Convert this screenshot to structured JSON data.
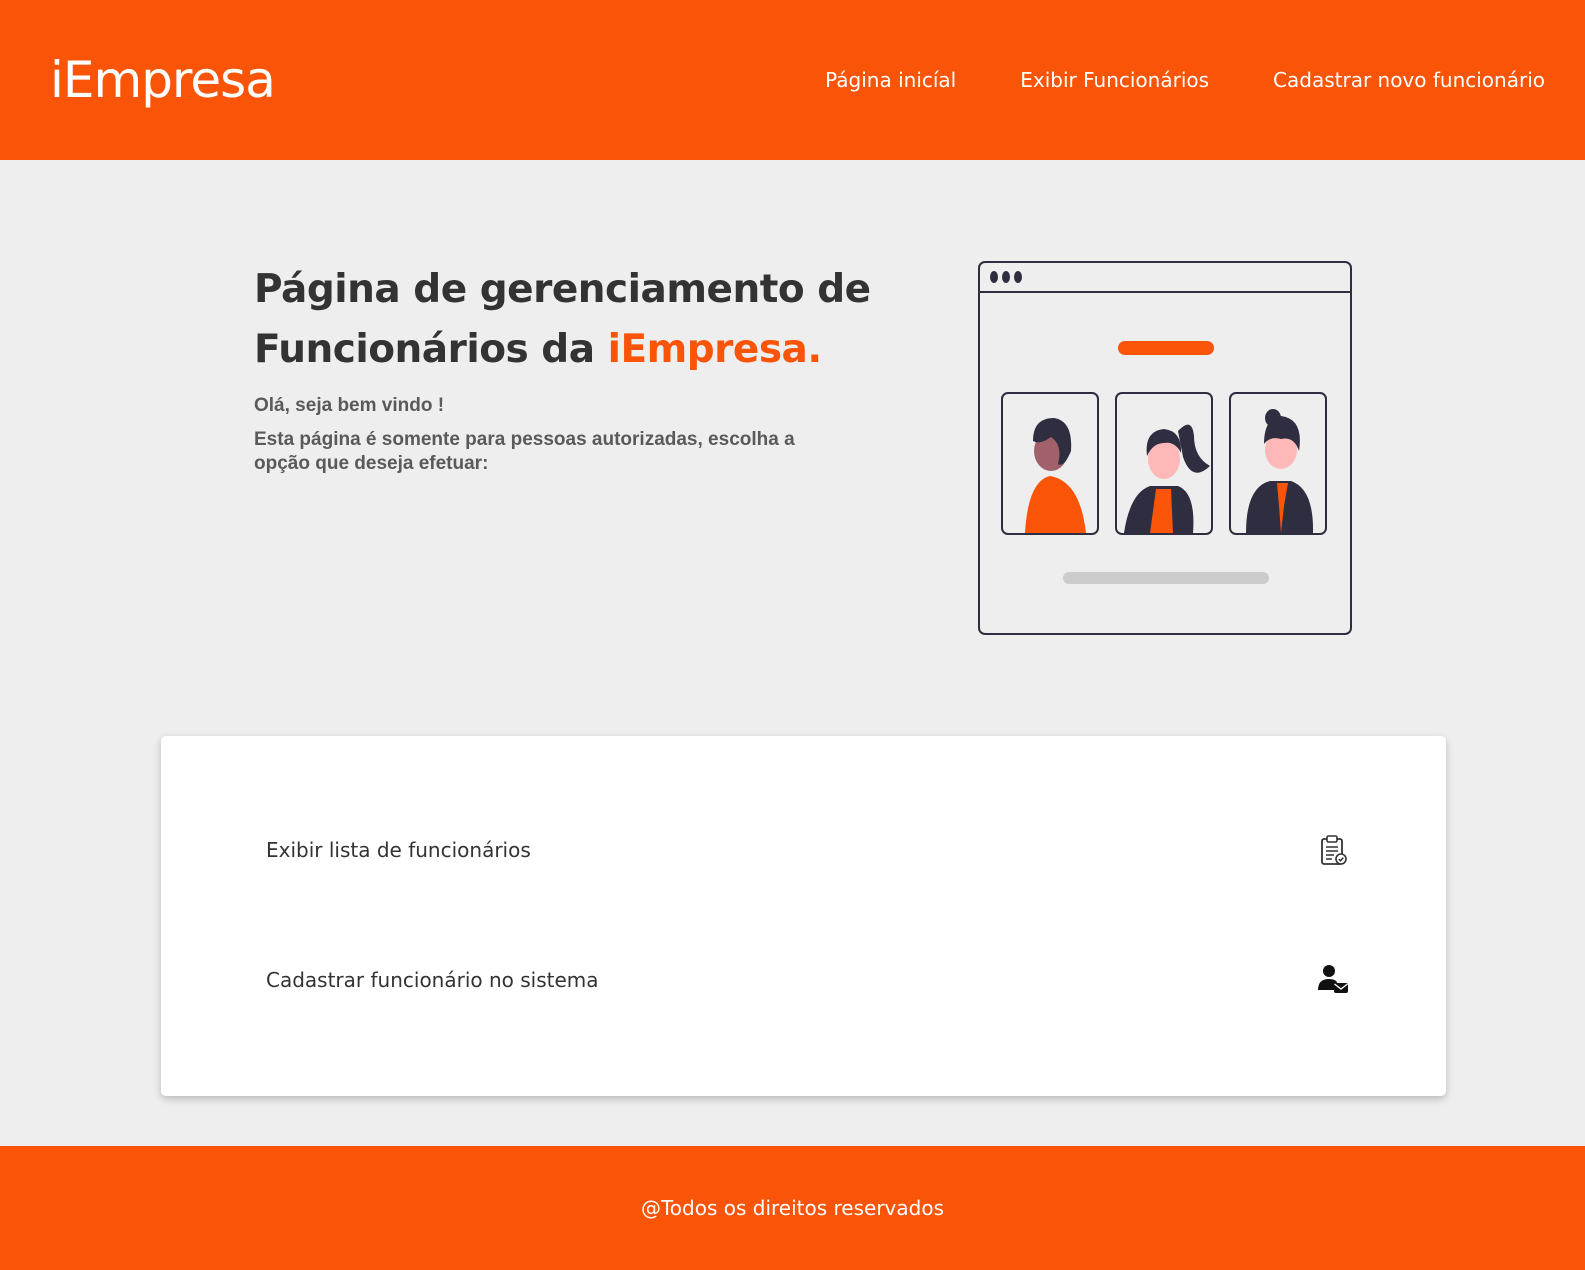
{
  "header": {
    "logo": "iEmpresa",
    "nav": [
      {
        "label": "Página inicíal"
      },
      {
        "label": "Exibir Funcionários"
      },
      {
        "label": "Cadastrar novo funcionário"
      }
    ]
  },
  "hero": {
    "title_part1": "Página de gerenciamento de",
    "title_part2": "Funcionários da ",
    "title_accent": "iEmpresa.",
    "greeting": "Olá, seja bem vindo !",
    "description": "Esta página é somente para pessoas autorizadas, escolha a opção que deseja efetuar:"
  },
  "options": [
    {
      "label": "Exibir lista de funcionários",
      "icon": "clipboard-check-icon"
    },
    {
      "label": "Cadastrar funcionário no sistema",
      "icon": "user-add-icon"
    }
  ],
  "footer": {
    "text": "@Todos os direitos reservados"
  },
  "colors": {
    "accent": "#f95407",
    "background": "#eeeeee",
    "text": "#333333",
    "illustration_dark": "#2f2e41"
  }
}
